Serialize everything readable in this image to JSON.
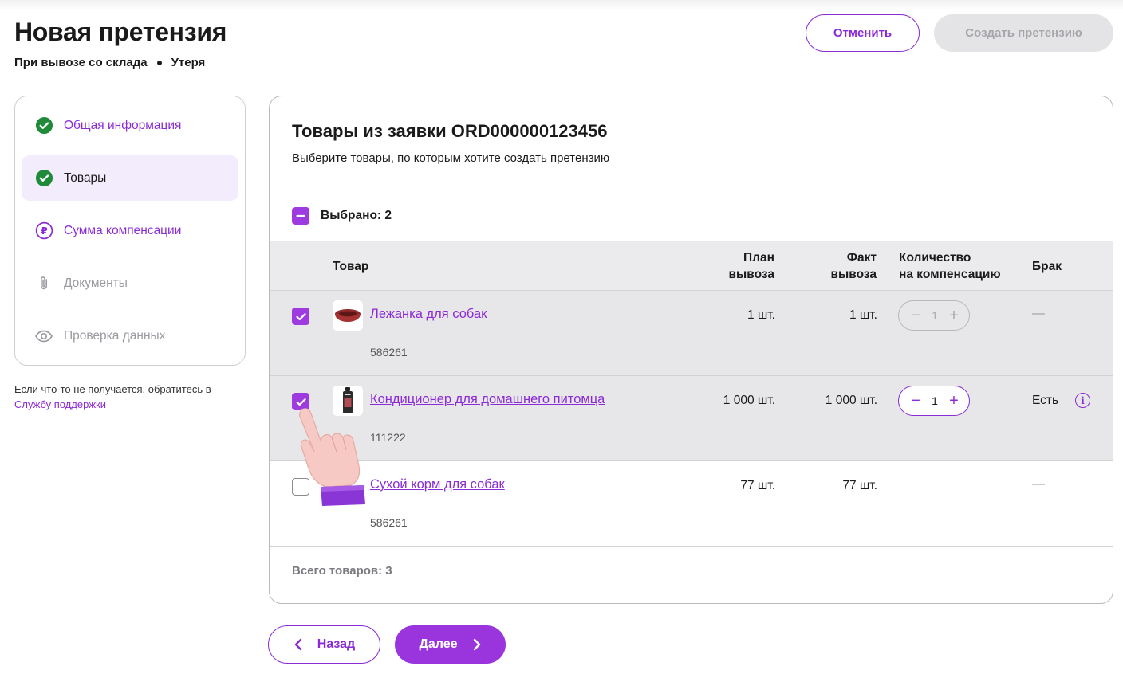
{
  "header": {
    "title": "Новая претензия",
    "subtitle_part1": "При вывозе со склада",
    "subtitle_part2": "Утеря",
    "cancel_label": "Отменить",
    "create_label": "Создать претензию"
  },
  "sidebar": {
    "steps": [
      {
        "label": "Общая информация",
        "state": "done-link",
        "icon": "check-circle-icon"
      },
      {
        "label": "Товары",
        "state": "done-active",
        "icon": "check-circle-icon"
      },
      {
        "label": "Сумма компенсации",
        "state": "link",
        "icon": "ruble-circle-icon"
      },
      {
        "label": "Документы",
        "state": "disabled",
        "icon": "paperclip-icon"
      },
      {
        "label": "Проверка данных",
        "state": "disabled",
        "icon": "eye-icon"
      }
    ],
    "help_text": "Если что-то не получается, обратитесь в",
    "help_link": "Службу поддержки"
  },
  "card": {
    "title": "Товары из заявки ORD000000123456",
    "subtitle": "Выберите товары, по которым хотите создать претензию",
    "selected_label": "Выбрано: 2",
    "columns": {
      "product": "Товар",
      "plan_line1": "План",
      "plan_line2": "вывоза",
      "fact_line1": "Факт",
      "fact_line2": "вывоза",
      "qty_line1": "Количество",
      "qty_line2": "на компенсацию",
      "defect": "Брак"
    },
    "rows": [
      {
        "name": "Лежанка для собак",
        "sku": "586261",
        "plan": "1 шт.",
        "fact": "1 шт.",
        "qty": "1",
        "defect": "—",
        "checked": true,
        "qty_enabled": false,
        "thumb": "dog-bed-thumbnail"
      },
      {
        "name": "Кондиционер для домашнего питомца",
        "sku": "111222",
        "plan": "1 000 шт.",
        "fact": "1 000 шт.",
        "qty": "1",
        "defect": "Есть",
        "checked": true,
        "qty_enabled": true,
        "thumb": "conditioner-bottle-thumbnail"
      },
      {
        "name": "Сухой корм для собак",
        "sku": "586261",
        "plan": "77 шт.",
        "fact": "77 шт.",
        "qty": "",
        "defect": "—",
        "checked": false,
        "qty_enabled": false,
        "thumb": ""
      }
    ],
    "total_label": "Всего товаров: 3"
  },
  "footer": {
    "back_label": "Назад",
    "next_label": "Далее"
  },
  "colors": {
    "accent": "#8b2bd6",
    "accent_fill": "#9a35de",
    "success": "#1f8a3a",
    "selected_row_bg": "#e7e7e9",
    "active_step_bg": "#f3ecfd"
  }
}
